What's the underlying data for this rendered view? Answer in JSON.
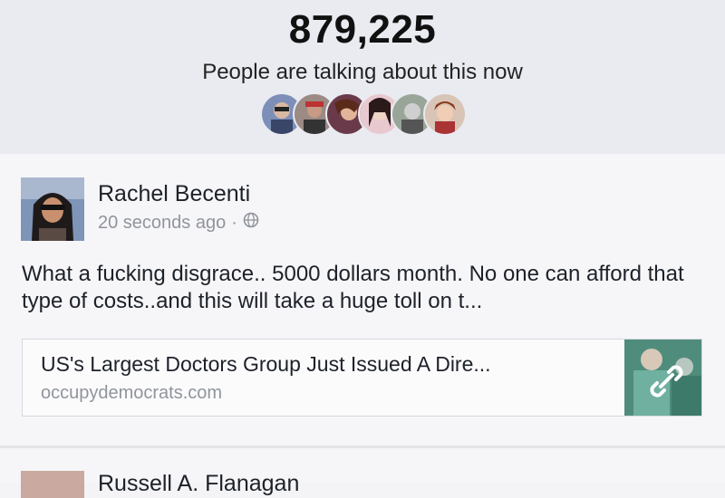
{
  "summary": {
    "count": "879,225",
    "subtitle": "People are talking about this now",
    "avatars": [
      "avatar-1",
      "avatar-2",
      "avatar-3",
      "avatar-4",
      "avatar-5",
      "avatar-6"
    ]
  },
  "post": {
    "author": "Rachel Becenti",
    "timestamp": "20 seconds ago",
    "separator": "·",
    "privacy_icon": "globe-icon",
    "text": "What a fucking disgrace.. 5000 dollars month. No one can afford that type of costs..and this will take a huge toll on t...",
    "link": {
      "title": "US's Largest Doctors Group Just Issued A Dire...",
      "domain": "occupydemocrats.com",
      "thumb_icon": "link-icon"
    }
  },
  "next_post": {
    "author": "Russell A. Flanagan"
  },
  "colors": {
    "header_bg": "#e9ebf1",
    "secondary_text": "#90949c"
  }
}
